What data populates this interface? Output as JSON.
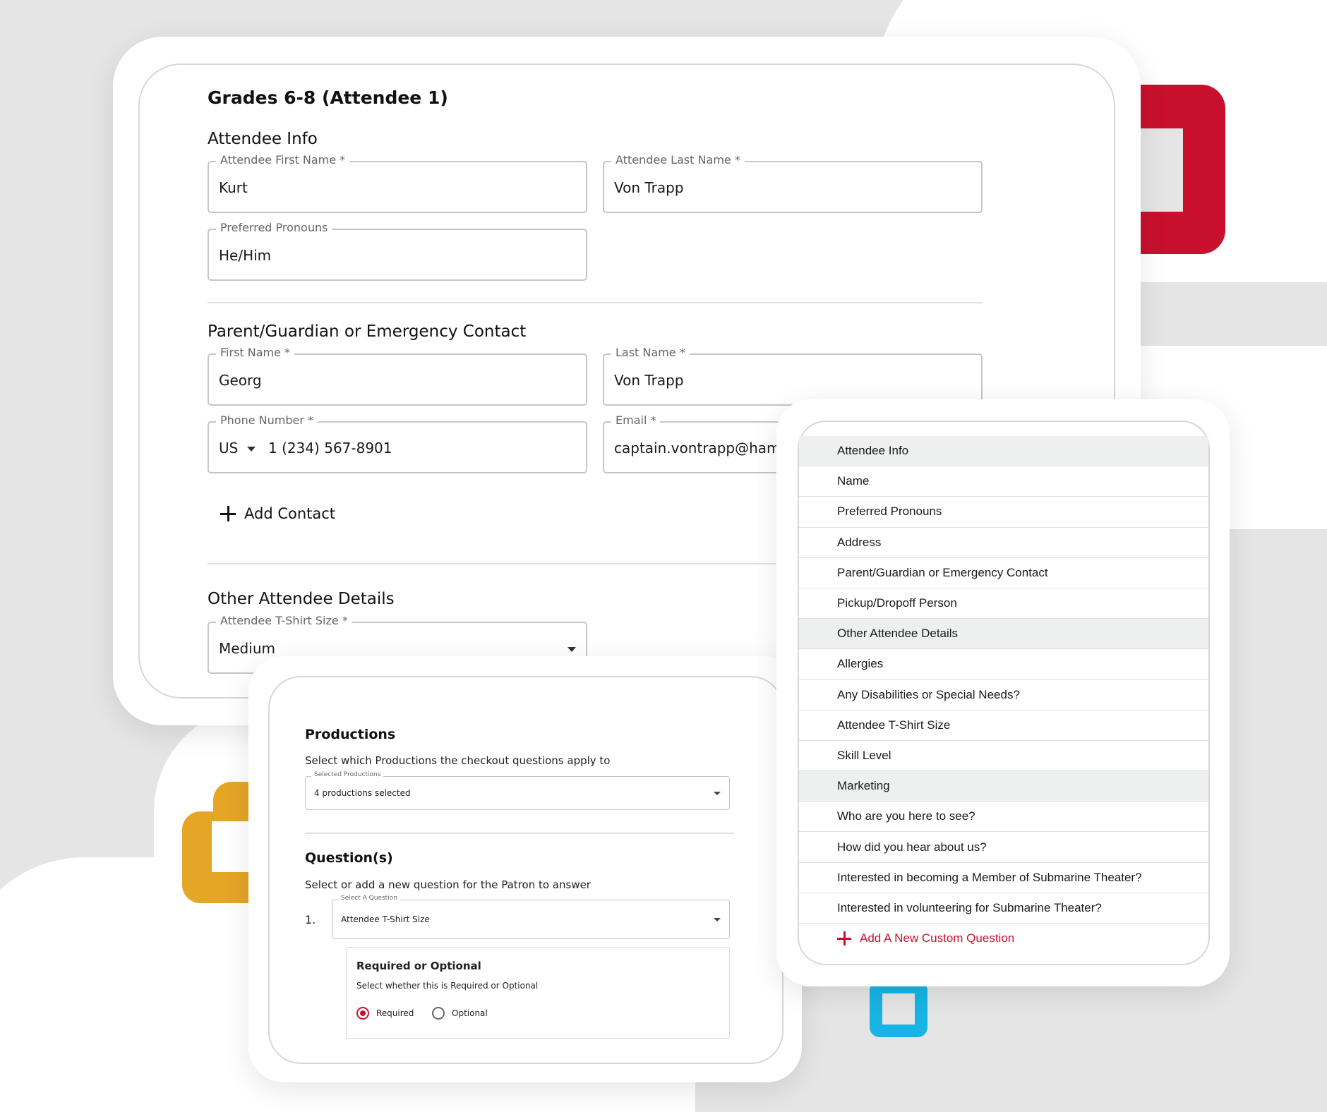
{
  "form": {
    "title": "Grades 6-8 (Attendee 1)",
    "attendee_info": {
      "heading": "Attendee Info",
      "first_name": {
        "label": "Attendee First Name *",
        "value": "Kurt"
      },
      "last_name": {
        "label": "Attendee Last Name *",
        "value": "Von Trapp"
      },
      "pronouns": {
        "label": "Preferred Pronouns",
        "value": "He/Him"
      }
    },
    "contact": {
      "heading": "Parent/Guardian or Emergency Contact",
      "first_name": {
        "label": "First Name *",
        "value": "Georg"
      },
      "last_name": {
        "label": "Last Name *",
        "value": "Von Trapp"
      },
      "phone": {
        "label": "Phone Number *",
        "country": "US",
        "value": "1 (234) 567-8901"
      },
      "email": {
        "label": "Email *",
        "value": "captain.vontrapp@hamme"
      },
      "add_contact": "Add Contact"
    },
    "other_details": {
      "heading": "Other Attendee Details",
      "tshirt": {
        "label": "Attendee T-Shirt Size *",
        "value": "Medium"
      }
    }
  },
  "productions_panel": {
    "productions_heading": "Productions",
    "productions_text": "Select which Productions the checkout questions apply to",
    "selected_productions": {
      "label": "Selected Productions",
      "value": "4 productions selected"
    },
    "questions_heading": "Question(s)",
    "questions_text": "Select or add a new question for the Patron to answer",
    "question_number": "1.",
    "select_question": {
      "label": "Select A Question",
      "value": "Attendee T-Shirt Size"
    },
    "required_optional": {
      "heading": "Required or Optional",
      "text": "Select whether this is Required or Optional",
      "options": [
        "Required",
        "Optional"
      ],
      "selected": "Required"
    }
  },
  "question_list": {
    "items": [
      {
        "label": "Attendee Info",
        "group": true
      },
      {
        "label": "Name",
        "group": false
      },
      {
        "label": "Preferred Pronouns",
        "group": false
      },
      {
        "label": "Address",
        "group": false
      },
      {
        "label": "Parent/Guardian or Emergency Contact",
        "group": false
      },
      {
        "label": "Pickup/Dropoff Person",
        "group": false
      },
      {
        "label": "Other Attendee Details",
        "group": true
      },
      {
        "label": "Allergies",
        "group": false
      },
      {
        "label": "Any Disabilities or Special Needs?",
        "group": false
      },
      {
        "label": "Attendee T-Shirt Size",
        "group": false
      },
      {
        "label": "Skill Level",
        "group": false
      },
      {
        "label": "Marketing",
        "group": true
      },
      {
        "label": "Who are you here to see?",
        "group": false
      },
      {
        "label": "How did you hear about us?",
        "group": false
      },
      {
        "label": "Interested in becoming a Member of Submarine Theater?",
        "group": false
      },
      {
        "label": "Interested in volunteering for Submarine Theater?",
        "group": false
      }
    ],
    "add_custom": "Add A New Custom Question"
  },
  "colors": {
    "accent_red": "#c8102e",
    "accent_yellow": "#e5a527",
    "accent_blue": "#17b4e4",
    "background": "#e5e5e5"
  }
}
